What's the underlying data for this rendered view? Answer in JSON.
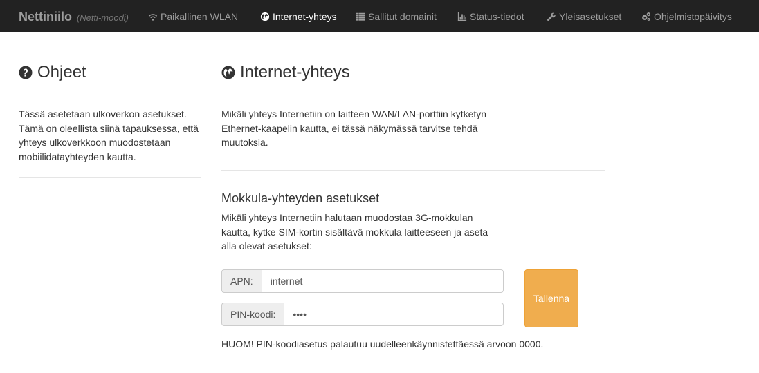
{
  "brand": {
    "name": "Nettiniilo",
    "subtitle": "(Netti-moodi)"
  },
  "nav": [
    {
      "label": "Paikallinen WLAN",
      "icon": "wifi-icon",
      "active": false
    },
    {
      "label": "Internet-yhteys",
      "icon": "globe-icon",
      "active": true
    },
    {
      "label": "Sallitut domainit",
      "icon": "list-icon",
      "active": false
    },
    {
      "label": "Status-tiedot",
      "icon": "bar-chart-icon",
      "active": false
    },
    {
      "label": "Yleisasetukset",
      "icon": "wrench-icon",
      "active": false
    },
    {
      "label": "Ohjelmistopäivitys",
      "icon": "cogs-icon",
      "active": false
    }
  ],
  "help": {
    "title": "Ohjeet",
    "text": "Tässä asetetaan ulkoverkon asetukset. Tämä on oleellista siinä tapauksessa, että yhteys ulkoverkkoon muodostetaan mobiilidatayhteyden kautta."
  },
  "main": {
    "title": "Internet-yhteys",
    "intro": "Mikäli yhteys Internetiin on laitteen WAN/LAN-porttiin kytketyn Ethernet-kaapelin kautta, ei tässä näkymässä tarvitse tehdä muutoksia.",
    "section_title": "Mokkula-yhteyden asetukset",
    "section_text": "Mikäli yhteys Internetiin halutaan muodostaa 3G-mokkulan kautta, kytke SIM-kortin sisältävä mokkula laitteeseen ja aseta alla olevat asetukset:",
    "apn_label": "APN:",
    "apn_value": "internet",
    "pin_label": "PIN-koodi:",
    "pin_value": "1234",
    "save_label": "Tallenna",
    "note": "HUOM! PIN-koodiasetus palautuu uudelleenkäynnistettäessä arvoon 0000."
  },
  "colors": {
    "navbar": "#222222",
    "nav_text": "#9d9d9d",
    "nav_active": "#ffffff",
    "save_button": "#f0ad4e"
  }
}
